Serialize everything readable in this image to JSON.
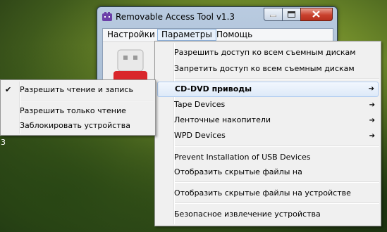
{
  "desktop": {
    "edge_text_top": "",
    "edge_text_mid": "3"
  },
  "window": {
    "title": "Removable Access Tool v1.3",
    "menubar": [
      "Настройки",
      "Параметры",
      "Помощь"
    ]
  },
  "main_menu": {
    "items": [
      "Разрешить доступ ко всем съемным дискам",
      "Запретить доступ ко всем съемным дискам",
      "CD-DVD приводы",
      "Tape Devices",
      "Ленточные накопители",
      "WPD Devices",
      "Prevent Installation of USB Devices",
      "Отобразить скрытые файлы на",
      "Отобразить скрытые файлы на устройстве",
      "Безопасное извлечение устройства"
    ],
    "submenu_arrow": "➔"
  },
  "sub_menu": {
    "items": [
      "Разрешить чтение и запись",
      "Разрешить только чтение",
      "Заблокировать устройства"
    ],
    "checked": "✔"
  }
}
